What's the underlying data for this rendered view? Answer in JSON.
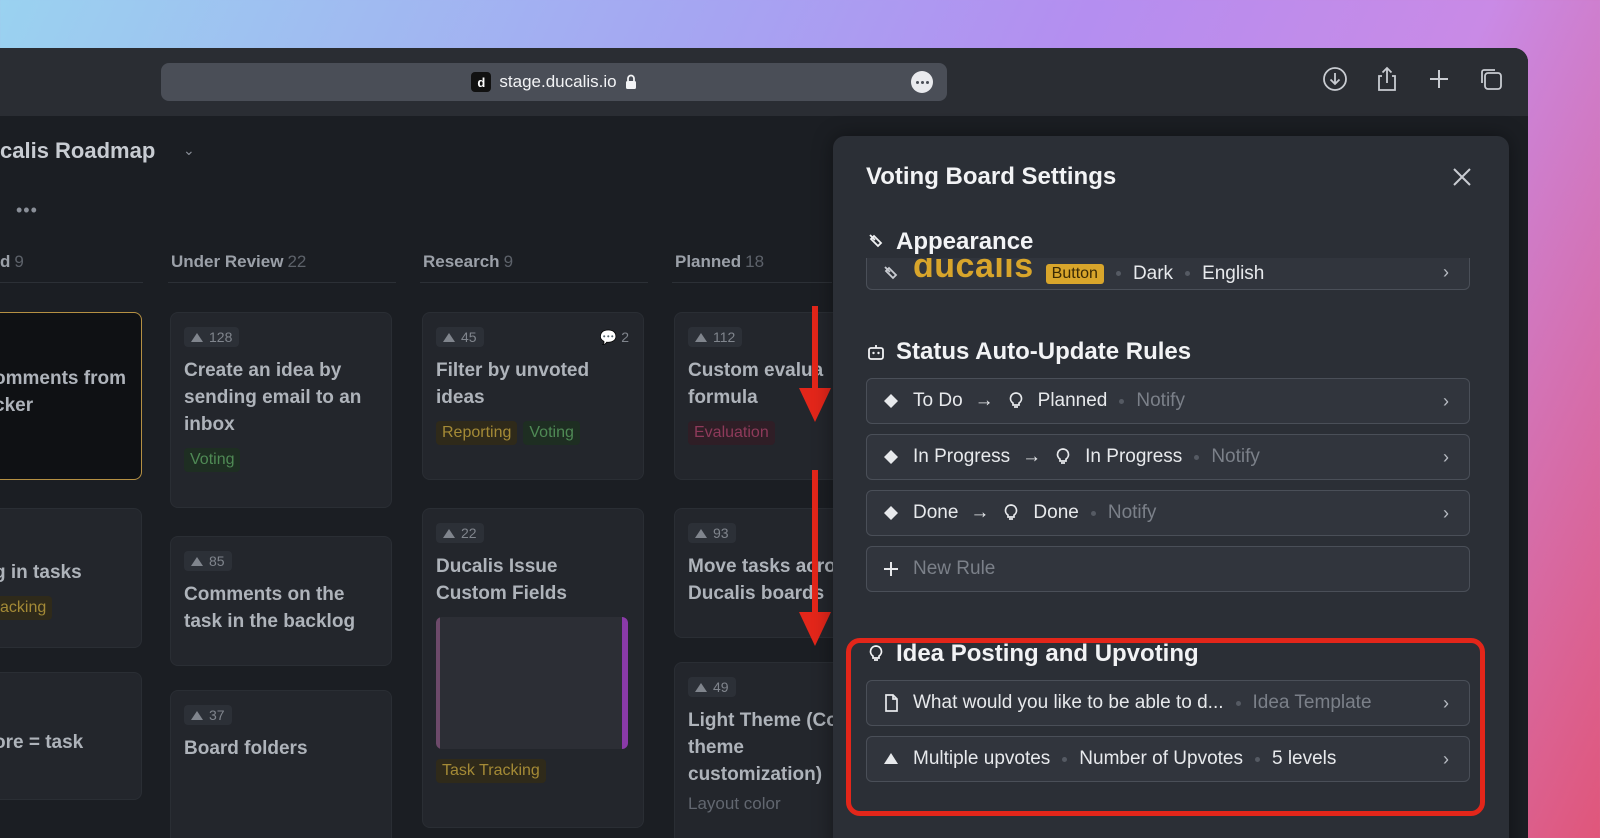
{
  "browser": {
    "url": "stage.ducalis.io",
    "favicon_letter": "d",
    "toolbar_icons": [
      "download-icon",
      "share-icon",
      "new-tab-icon",
      "tabs-overview-icon"
    ]
  },
  "board": {
    "project_title": "calis Roadmap",
    "columns": [
      {
        "name": "d",
        "count": "9"
      },
      {
        "name": "Under Review",
        "count": "22"
      },
      {
        "name": "Research",
        "count": "9"
      },
      {
        "name": "Planned",
        "count": "18"
      }
    ],
    "cards": {
      "c0a_title": "omments from\ncker",
      "c0b_title": "g in tasks",
      "c0b_tag": "acking",
      "c0c_title": "ore = task",
      "c1a_votes": "128",
      "c1a_title": "Create an idea by sending email to an inbox",
      "c1a_tag": "Voting",
      "c1b_votes": "85",
      "c1b_title": "Comments on the task in the backlog",
      "c1c_votes": "37",
      "c1c_title": "Board folders",
      "c2a_votes": "45",
      "c2a_comments": "2",
      "c2a_title": "Filter by unvoted ideas",
      "c2a_tag1": "Reporting",
      "c2a_tag2": "Voting",
      "c2b_votes": "22",
      "c2b_title": "Ducalis Issue Custom Fields",
      "c2b_tag": "Task Tracking",
      "c3a_votes": "112",
      "c3a_title": "Custom evalua\nformula",
      "c3a_tag": "Evaluation",
      "c3b_votes": "93",
      "c3b_title": "Move tasks acro\nDucalis boards",
      "c3c_votes": "49",
      "c3c_title": "Light Theme (Co\ntheme\ncustomization)",
      "c3c_sub": "Layout color"
    }
  },
  "panel": {
    "title": "Voting Board Settings",
    "appearance": {
      "title": "Appearance",
      "logo": "ducalis",
      "button_label": "Button",
      "theme": "Dark",
      "language": "English"
    },
    "status_rules": {
      "title": "Status Auto-Update Rules",
      "rules": [
        {
          "from": "To Do",
          "to": "Planned",
          "action": "Notify"
        },
        {
          "from": "In Progress",
          "to": "In Progress",
          "action": "Notify"
        },
        {
          "from": "Done",
          "to": "Done",
          "action": "Notify"
        }
      ],
      "new_rule": "New Rule"
    },
    "idea_posting": {
      "title": "Idea Posting and Upvoting",
      "template_text": "What would you like to be able to d...",
      "template_label": "Idea Template",
      "upvote_mode": "Multiple upvotes",
      "upvote_label": "Number of Upvotes",
      "upvote_levels": "5 levels"
    }
  },
  "colors": {
    "annotation_red": "#e3261a",
    "brand_yellow": "#d8a52b",
    "panel_bg": "#2b2f36"
  }
}
